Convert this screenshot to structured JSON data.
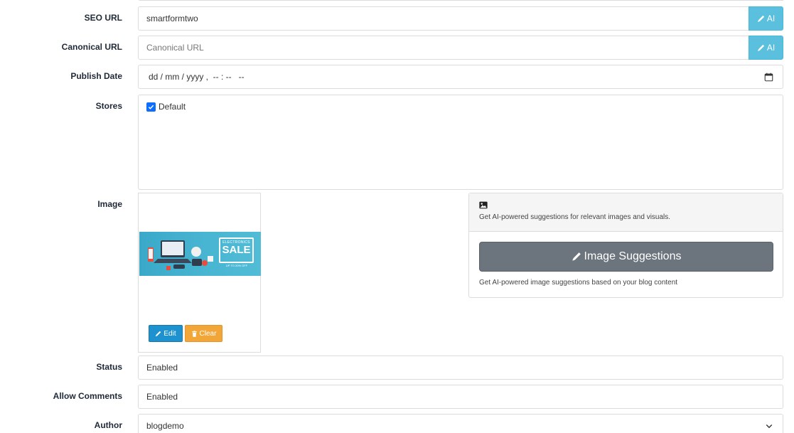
{
  "seo_url": {
    "label": "SEO URL",
    "value": "smartformtwo",
    "ai_label": "AI"
  },
  "canonical_url": {
    "label": "Canonical URL",
    "placeholder": "Canonical URL",
    "ai_label": "AI"
  },
  "publish_date": {
    "label": "Publish Date",
    "value": "dd / mm / yyyy ,  -- : --   --"
  },
  "stores": {
    "label": "Stores",
    "options": [
      {
        "label": "Default",
        "checked": true
      }
    ]
  },
  "image": {
    "label": "Image",
    "banner": {
      "small_text": "ELECTRONICS",
      "big_text": "SALE",
      "sub_text": "UP TO 20% OFF"
    },
    "edit_label": "Edit",
    "clear_label": "Clear"
  },
  "ai_images": {
    "header_desc": "Get AI-powered suggestions for relevant images and visuals.",
    "button_label": "Image Suggestions",
    "footer_desc": "Get AI-powered image suggestions based on your blog content"
  },
  "status": {
    "label": "Status",
    "value": "Enabled"
  },
  "allow_comments": {
    "label": "Allow Comments",
    "value": "Enabled"
  },
  "author": {
    "label": "Author",
    "value": "blogdemo"
  },
  "colors": {
    "ai_button": "#5bc0de",
    "edit_button": "#1e91cf",
    "clear_button": "#f3a638",
    "suggest_button": "#6c757d",
    "checkbox": "#0d6efd"
  },
  "icons": {
    "ai": "pencil-icon",
    "calendar": "calendar-icon",
    "image": "image-icon",
    "trash": "trash-icon",
    "chevron": "chevron-down-icon"
  }
}
